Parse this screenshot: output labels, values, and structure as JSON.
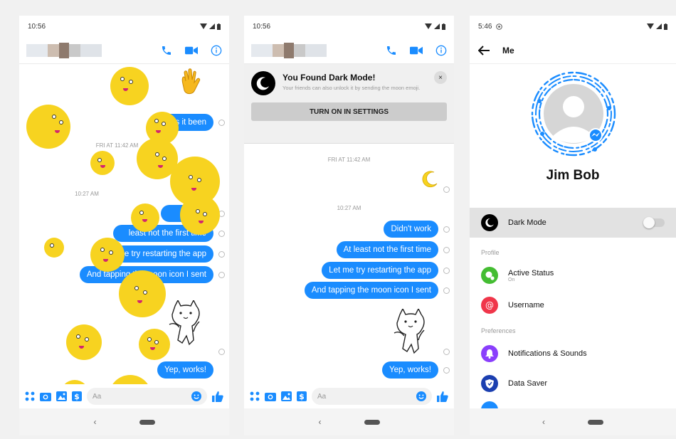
{
  "phone1": {
    "status": {
      "time": "10:56"
    },
    "timestamps": {
      "first": "FRI AT 11:42 AM",
      "second": "10:27 AM"
    },
    "messages": [
      {
        "text": "s it been"
      },
      {
        "text": "work"
      },
      {
        "text": "least not the first time"
      },
      {
        "text": "Let me try restarting the app"
      },
      {
        "text": "And tapping the moon icon I sent"
      },
      {
        "text": "Yep, works!"
      }
    ],
    "composer": {
      "placeholder": "Aa"
    }
  },
  "phone2": {
    "status": {
      "time": "10:56"
    },
    "dark_mode_card": {
      "title": "You Found Dark Mode!",
      "description": "Your friends can also unlock it by sending the moon emoji.",
      "button": "TURN ON IN SETTINGS",
      "close": "×"
    },
    "timestamps": {
      "first": "FRI AT 11:42 AM",
      "second": "10:27 AM"
    },
    "messages": [
      {
        "text": "Didn't work"
      },
      {
        "text": "At least not the first time"
      },
      {
        "text": "Let me try restarting the app"
      },
      {
        "text": "And tapping the moon icon I sent"
      },
      {
        "text": "Yep, works!"
      }
    ],
    "composer": {
      "placeholder": "Aa"
    }
  },
  "phone3": {
    "status": {
      "time": "5:46"
    },
    "header": {
      "title": "Me"
    },
    "profile": {
      "name": "Jim Bob"
    },
    "dark_mode": {
      "label": "Dark Mode",
      "enabled": false
    },
    "sections": {
      "profile": "Profile",
      "preferences": "Preferences"
    },
    "items": {
      "active_status": {
        "label": "Active Status",
        "sub": "On"
      },
      "username": {
        "label": "Username"
      },
      "notifications": {
        "label": "Notifications & Sounds"
      },
      "data_saver": {
        "label": "Data Saver"
      }
    }
  },
  "colors": {
    "accent": "#1a8cff",
    "moon_yellow": "#f7d320",
    "active_status_green": "#44bd32",
    "username_red": "#f0364a",
    "notifications_purple": "#8a3ffc",
    "data_saver_blue": "#1b3fb0"
  },
  "icons": {
    "call": "phone-icon",
    "video": "video-camera-icon",
    "info": "info-icon",
    "back": "arrow-left-icon",
    "like": "thumbs-up-icon"
  }
}
